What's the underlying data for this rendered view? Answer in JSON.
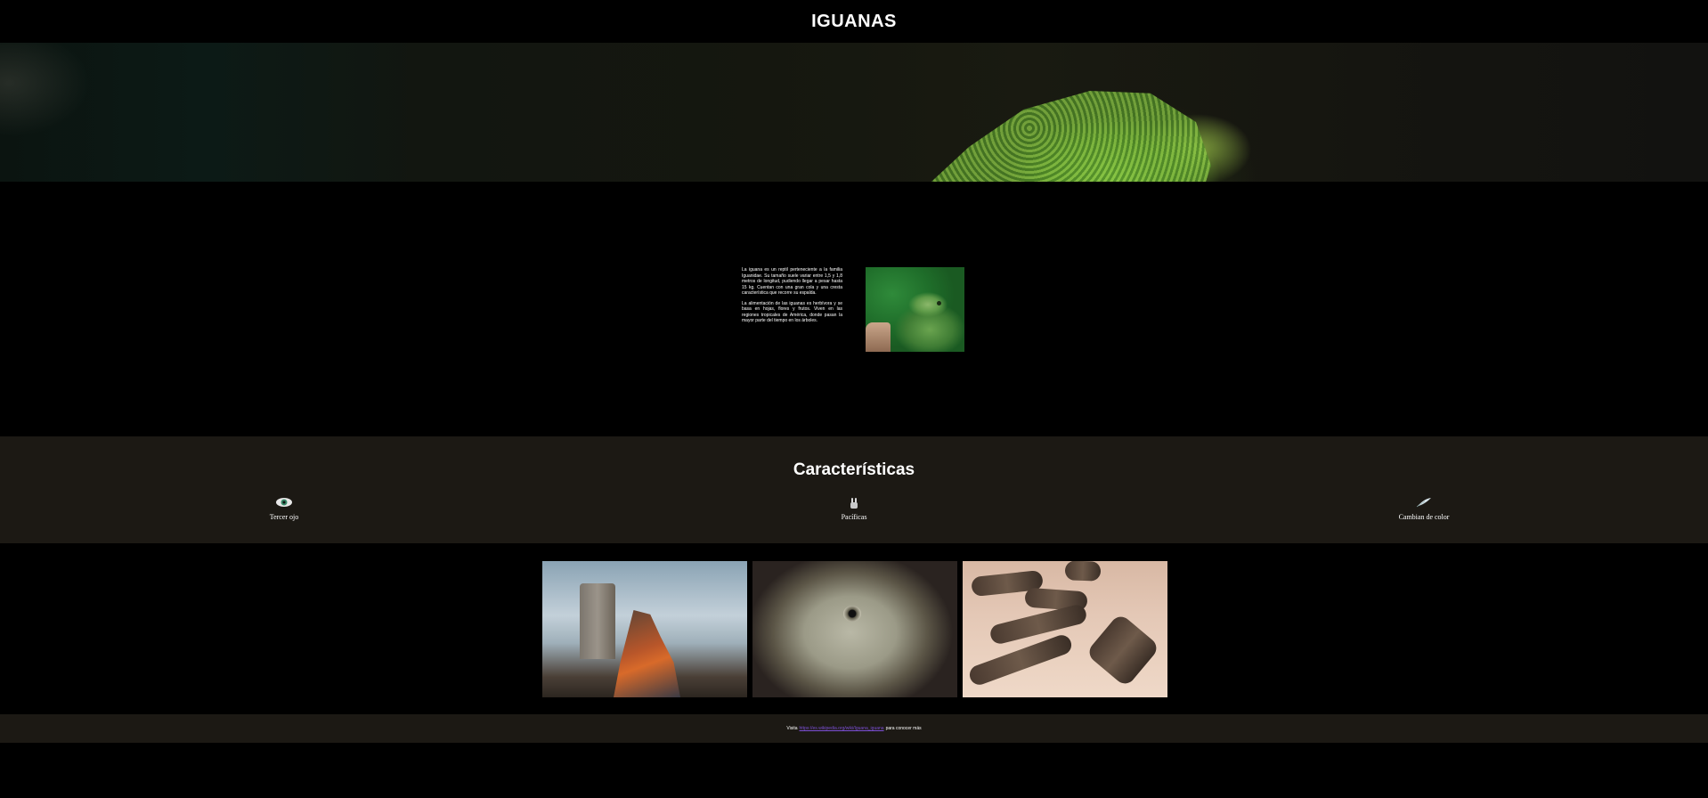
{
  "header": {
    "title": "IGUANAS"
  },
  "intro": {
    "paragraphs": [
      "La iguana es un reptil perteneciente a la familia Iguanidae. Su tamaño suele variar entre 1,5 y 1,8 metros de longitud, pudiendo llegar a pesar hasta 15 kg. Cuentan con una gran cola y una cresta característica que recorre su espalda.",
      "La alimentación de las iguanas es herbívora y se basa en hojas, flores y frutos. Viven en las regiones tropicales de América, donde pasan la mayor parte del tiempo en los árboles."
    ],
    "image_alt": "Iguana verde"
  },
  "features": {
    "title": "Características",
    "items": [
      {
        "label": "Tercer ojo",
        "icon": "eye-icon"
      },
      {
        "label": "Pacíficas",
        "icon": "peace-hand-icon"
      },
      {
        "label": "Cambian de color",
        "icon": "feather-icon"
      }
    ]
  },
  "gallery": {
    "photos": [
      {
        "alt": "Iguana naranja junto a un poste en la orilla"
      },
      {
        "alt": "Primer plano de la cabeza de una iguana"
      },
      {
        "alt": "Grupo de iguanas en la arena"
      }
    ]
  },
  "footer": {
    "prefix": "Visita",
    "link_text": "https://es.wikipedia.org/wiki/Iguana_iguana",
    "suffix": "para conocer más"
  },
  "colors": {
    "background": "#000000",
    "band": "#1c1914",
    "link": "#7c4fd6"
  }
}
